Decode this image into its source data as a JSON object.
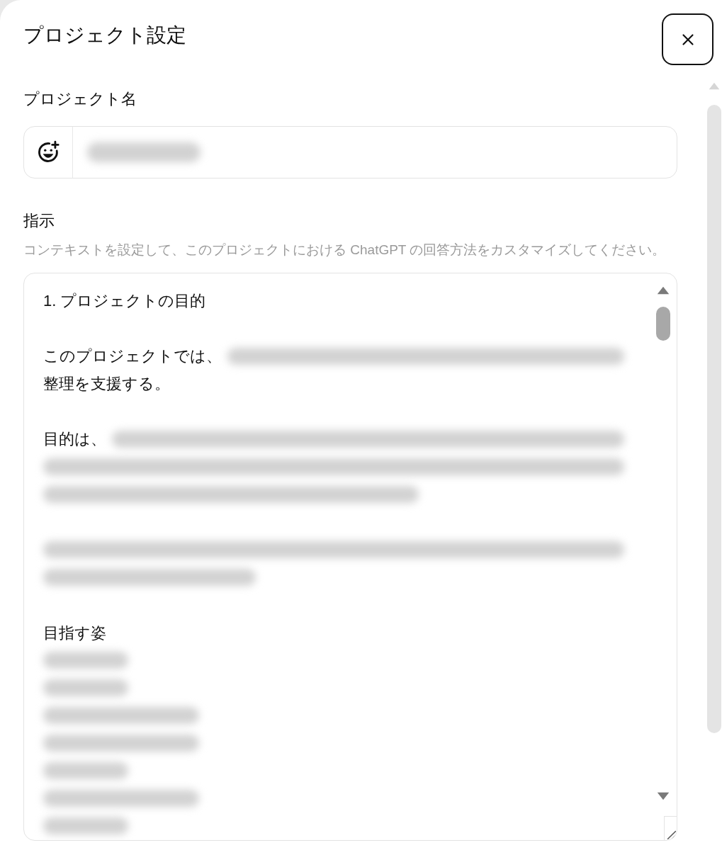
{
  "dialog": {
    "title": "プロジェクト設定"
  },
  "project_name": {
    "label": "プロジェクト名",
    "value_redacted": true
  },
  "instructions": {
    "label": "指示",
    "hint": "コンテキストを設定して、このプロジェクトにおける ChatGPT の回答方法をカスタマイズしてください。",
    "lines": [
      {
        "kind": "text",
        "text": "1. プロジェクトの目的",
        "redacted_tail": false
      },
      {
        "kind": "blank"
      },
      {
        "kind": "text",
        "text": "このプロジェクトでは、",
        "redacted_tail": true
      },
      {
        "kind": "text",
        "text": "整理を支援する。",
        "redacted_tail": false
      },
      {
        "kind": "blank"
      },
      {
        "kind": "text",
        "text": "目的は、",
        "redacted_tail": true
      },
      {
        "kind": "redacted"
      },
      {
        "kind": "redacted"
      },
      {
        "kind": "blank"
      },
      {
        "kind": "redacted"
      },
      {
        "kind": "redacted"
      },
      {
        "kind": "blank"
      },
      {
        "kind": "text",
        "text": "目指す姿",
        "redacted_tail": false
      },
      {
        "kind": "redacted"
      },
      {
        "kind": "redacted"
      },
      {
        "kind": "redacted"
      },
      {
        "kind": "redacted"
      },
      {
        "kind": "redacted"
      },
      {
        "kind": "redacted"
      },
      {
        "kind": "redacted"
      }
    ]
  }
}
